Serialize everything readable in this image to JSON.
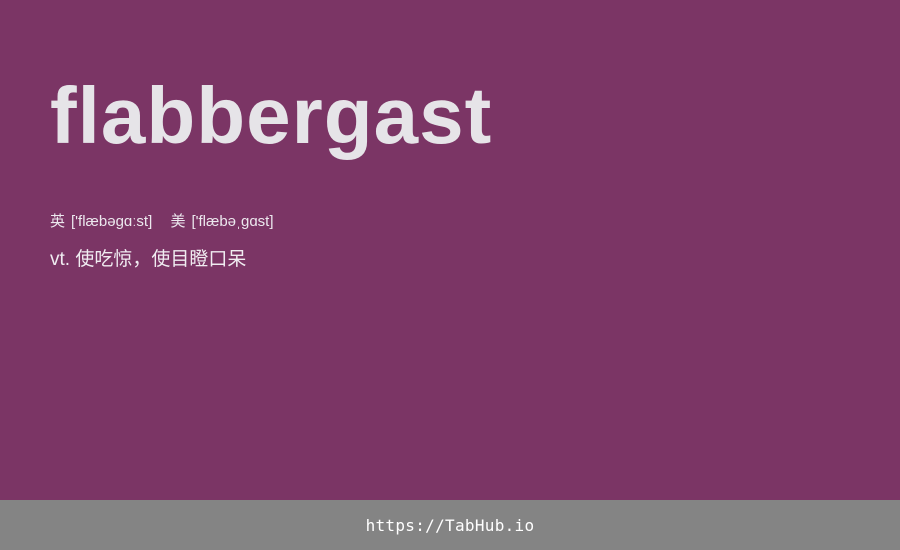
{
  "word": {
    "text": "flabbergast",
    "text_color": "#e6e4e8"
  },
  "phonetics": [
    {
      "label": "英",
      "ipa": "['flæbəgɑːst]"
    },
    {
      "label": "美",
      "ipa": "['flæbəˌɡɑst]"
    }
  ],
  "definition": "vt. 使吃惊，使目瞪口呆",
  "footer": {
    "link_text": "https://TabHub.io"
  },
  "colors": {
    "background": "#7b3565",
    "footer_background": "#848484",
    "footer_text": "#ffffff"
  }
}
